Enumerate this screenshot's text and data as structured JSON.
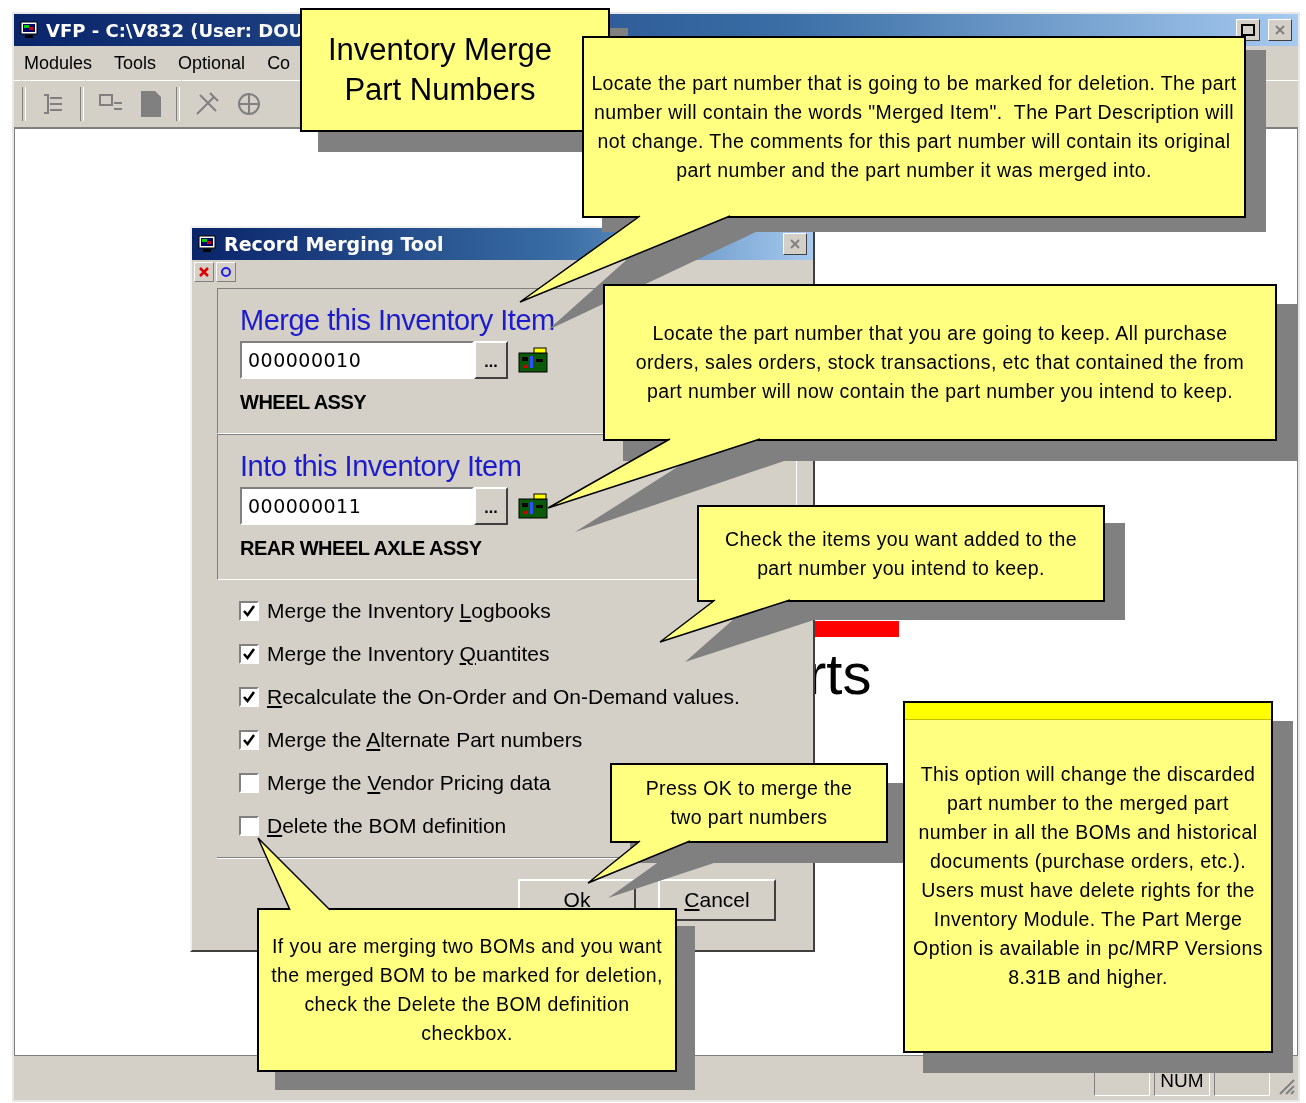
{
  "app_window": {
    "title": "VFP - C:\\V832  (User: DOU",
    "menu": [
      "Modules",
      "Tools",
      "Optional",
      "Co"
    ],
    "status_bar": {
      "indicator": "NUM"
    }
  },
  "logo": {
    "word": "rts"
  },
  "dialog": {
    "title": "Record Merging Tool",
    "groups": [
      {
        "heading": "Merge this Inventory Item",
        "part_number": "000000010",
        "browse": "...",
        "description": "WHEEL ASSY"
      },
      {
        "heading": "Into this Inventory Item",
        "part_number": "000000011",
        "browse": "...",
        "description": "REAR WHEEL AXLE ASSY"
      }
    ],
    "options": [
      {
        "label_before": "Merge the Inventory ",
        "access_key": "L",
        "label_after": "ogbooks",
        "checked": true
      },
      {
        "label_before": "Merge the Inventory ",
        "access_key": "Q",
        "label_after": "uantites",
        "checked": true
      },
      {
        "access_key": "R",
        "label_after": "ecalculate the On-Order and On-Demand values.",
        "checked": true
      },
      {
        "label_before": "Merge the ",
        "access_key": "A",
        "label_after": "lternate Part numbers",
        "checked": true
      },
      {
        "label_before": "Merge the ",
        "access_key": "V",
        "label_after": "endor Pricing data",
        "checked": false
      },
      {
        "access_key": "D",
        "label_after": "elete the BOM definition",
        "checked": false
      }
    ],
    "buttons": [
      {
        "label_after": "Ok"
      },
      {
        "access_key": "C",
        "label_after": "ancel"
      }
    ]
  },
  "callouts": [
    {
      "kind": "heading",
      "banner": false,
      "text": "Inventory Merge Part Numbers"
    },
    {
      "kind": "note",
      "banner": false,
      "text": "Locate the part number that is going to be marked for deletion. The part number will contain the words \"Merged Item\".  The Part Description will not change. The comments for this part number will contain its original part number and the part number it was merged into."
    },
    {
      "kind": "note",
      "banner": false,
      "text": "Locate the part number that you are going to keep. All purchase orders, sales orders, stock transactions, etc that contained the from part number will now contain the part number you intend to keep."
    },
    {
      "kind": "note",
      "banner": false,
      "text": "Check the items you want added to the part number you intend to keep."
    },
    {
      "kind": "note",
      "banner": false,
      "text": "Press OK to merge the two part numbers"
    },
    {
      "kind": "note",
      "banner": false,
      "text": "If you are merging two BOMs and you want the merged BOM to be marked for deletion, check the Delete the BOM definition checkbox."
    },
    {
      "kind": "note",
      "banner": true,
      "text": "This option will change the discarded part number to the merged part number in all the BOMs and historical documents (purchase orders, etc.).  Users must have delete rights for the Inventory Module. The Part Merge Option is available in pc/MRP Versions 8.31B and higher."
    }
  ]
}
